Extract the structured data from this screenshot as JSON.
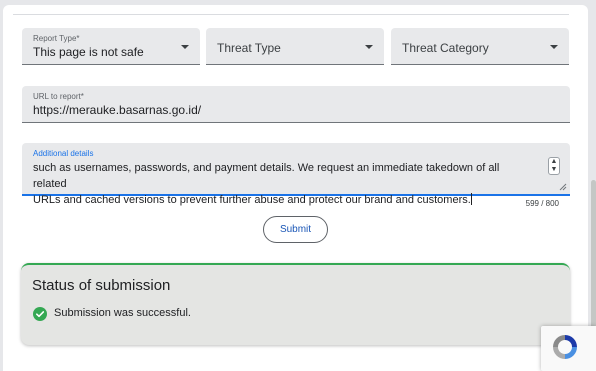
{
  "form": {
    "report_type": {
      "label": "Report Type*",
      "value": "This page is not safe"
    },
    "threat_type": {
      "placeholder": "Threat Type"
    },
    "threat_category": {
      "placeholder": "Threat Category"
    },
    "url": {
      "label": "URL to report*",
      "value": "https://merauke.basarnas.go.id/"
    },
    "details": {
      "label": "Additional details",
      "line1": "such as usernames, passwords, and payment details. We request an immediate takedown of all related",
      "line2": "URLs and cached versions to prevent further abuse and protect our brand and customers.",
      "counter": "599 / 800"
    },
    "submit_label": "Submit"
  },
  "status": {
    "title": "Status of submission",
    "message": "Submission was successful."
  },
  "colors": {
    "accent": "#1a73e8",
    "success": "#34a853",
    "field_bg": "#e8e9eb"
  }
}
